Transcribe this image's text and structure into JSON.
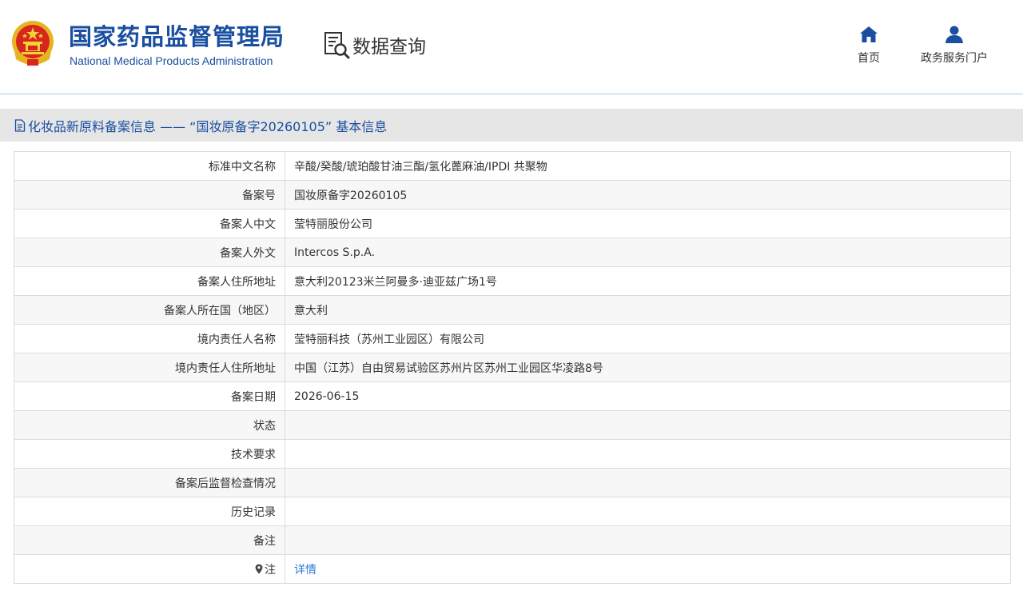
{
  "header": {
    "org_name_cn": "国家药品监督管理局",
    "org_name_en": "National Medical Products Administration",
    "query_title": "数据查询",
    "nav": [
      {
        "label": "首页",
        "icon": "home-icon"
      },
      {
        "label": "政务服务门户",
        "icon": "user-icon"
      }
    ],
    "accent_color": "#1a4ea0"
  },
  "section": {
    "title": "化妆品新原料备案信息 —— “国妆原备字20260105” 基本信息"
  },
  "rows": [
    {
      "label": "标准中文名称",
      "value": "辛酸/癸酸/琥珀酸甘油三酯/氢化蓖麻油/IPDI 共聚物"
    },
    {
      "label": "备案号",
      "value": "国妆原备字20260105"
    },
    {
      "label": "备案人中文",
      "value": "莹特丽股份公司"
    },
    {
      "label": "备案人外文",
      "value": "Intercos S.p.A."
    },
    {
      "label": "备案人住所地址",
      "value": "意大利20123米兰阿曼多·迪亚兹广场1号"
    },
    {
      "label": "备案人所在国（地区）",
      "value": "意大利"
    },
    {
      "label": "境内责任人名称",
      "value": "莹特丽科技（苏州工业园区）有限公司"
    },
    {
      "label": "境内责任人住所地址",
      "value": "中国（江苏）自由贸易试验区苏州片区苏州工业园区华凌路8号"
    },
    {
      "label": "备案日期",
      "value": "2026-06-15"
    },
    {
      "label": "状态",
      "value": ""
    },
    {
      "label": "技术要求",
      "value": ""
    },
    {
      "label": "备案后监督检查情况",
      "value": ""
    },
    {
      "label": "历史记录",
      "value": ""
    },
    {
      "label": "备注",
      "value": ""
    }
  ],
  "note_row": {
    "label": "注",
    "link_text": "详情",
    "link_color": "#2c7bd6"
  }
}
